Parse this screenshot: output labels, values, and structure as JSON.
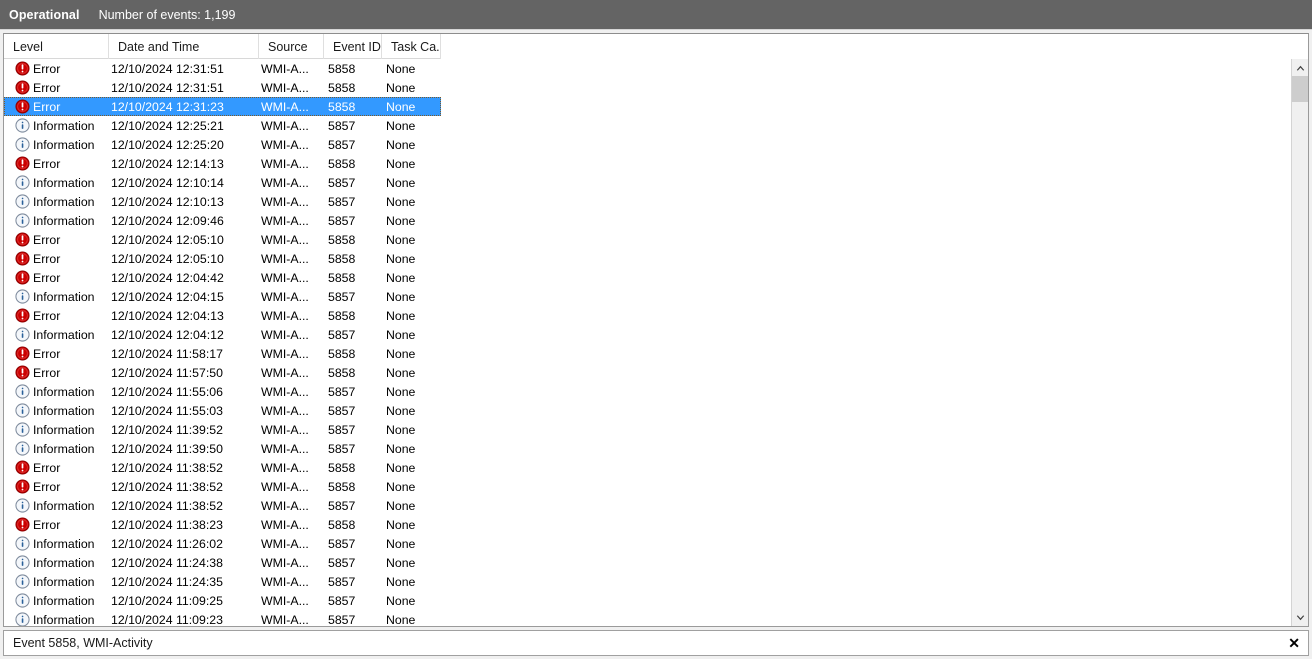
{
  "header": {
    "log_name": "Operational",
    "event_count_label": "Number of events: 1,199"
  },
  "columns": [
    {
      "key": "level",
      "label": "Level"
    },
    {
      "key": "datetime",
      "label": "Date and Time"
    },
    {
      "key": "source",
      "label": "Source"
    },
    {
      "key": "eventid",
      "label": "Event ID"
    },
    {
      "key": "task",
      "label": "Task Ca..."
    }
  ],
  "colors": {
    "titlebar_bg": "#646464",
    "selection_bg": "#3399ff",
    "error_icon": "#cc0000",
    "information_icon": "#2a6099"
  },
  "rows": [
    {
      "level": "Error",
      "icon": "error-icon",
      "datetime": "12/10/2024 12:31:51",
      "source": "WMI-A...",
      "eventid": "5858",
      "task": "None",
      "selected": false
    },
    {
      "level": "Error",
      "icon": "error-icon",
      "datetime": "12/10/2024 12:31:51",
      "source": "WMI-A...",
      "eventid": "5858",
      "task": "None",
      "selected": false
    },
    {
      "level": "Error",
      "icon": "error-icon",
      "datetime": "12/10/2024 12:31:23",
      "source": "WMI-A...",
      "eventid": "5858",
      "task": "None",
      "selected": true
    },
    {
      "level": "Information",
      "icon": "information-icon",
      "datetime": "12/10/2024 12:25:21",
      "source": "WMI-A...",
      "eventid": "5857",
      "task": "None",
      "selected": false
    },
    {
      "level": "Information",
      "icon": "information-icon",
      "datetime": "12/10/2024 12:25:20",
      "source": "WMI-A...",
      "eventid": "5857",
      "task": "None",
      "selected": false
    },
    {
      "level": "Error",
      "icon": "error-icon",
      "datetime": "12/10/2024 12:14:13",
      "source": "WMI-A...",
      "eventid": "5858",
      "task": "None",
      "selected": false
    },
    {
      "level": "Information",
      "icon": "information-icon",
      "datetime": "12/10/2024 12:10:14",
      "source": "WMI-A...",
      "eventid": "5857",
      "task": "None",
      "selected": false
    },
    {
      "level": "Information",
      "icon": "information-icon",
      "datetime": "12/10/2024 12:10:13",
      "source": "WMI-A...",
      "eventid": "5857",
      "task": "None",
      "selected": false
    },
    {
      "level": "Information",
      "icon": "information-icon",
      "datetime": "12/10/2024 12:09:46",
      "source": "WMI-A...",
      "eventid": "5857",
      "task": "None",
      "selected": false
    },
    {
      "level": "Error",
      "icon": "error-icon",
      "datetime": "12/10/2024 12:05:10",
      "source": "WMI-A...",
      "eventid": "5858",
      "task": "None",
      "selected": false
    },
    {
      "level": "Error",
      "icon": "error-icon",
      "datetime": "12/10/2024 12:05:10",
      "source": "WMI-A...",
      "eventid": "5858",
      "task": "None",
      "selected": false
    },
    {
      "level": "Error",
      "icon": "error-icon",
      "datetime": "12/10/2024 12:04:42",
      "source": "WMI-A...",
      "eventid": "5858",
      "task": "None",
      "selected": false
    },
    {
      "level": "Information",
      "icon": "information-icon",
      "datetime": "12/10/2024 12:04:15",
      "source": "WMI-A...",
      "eventid": "5857",
      "task": "None",
      "selected": false
    },
    {
      "level": "Error",
      "icon": "error-icon",
      "datetime": "12/10/2024 12:04:13",
      "source": "WMI-A...",
      "eventid": "5858",
      "task": "None",
      "selected": false
    },
    {
      "level": "Information",
      "icon": "information-icon",
      "datetime": "12/10/2024 12:04:12",
      "source": "WMI-A...",
      "eventid": "5857",
      "task": "None",
      "selected": false
    },
    {
      "level": "Error",
      "icon": "error-icon",
      "datetime": "12/10/2024 11:58:17",
      "source": "WMI-A...",
      "eventid": "5858",
      "task": "None",
      "selected": false
    },
    {
      "level": "Error",
      "icon": "error-icon",
      "datetime": "12/10/2024 11:57:50",
      "source": "WMI-A...",
      "eventid": "5858",
      "task": "None",
      "selected": false
    },
    {
      "level": "Information",
      "icon": "information-icon",
      "datetime": "12/10/2024 11:55:06",
      "source": "WMI-A...",
      "eventid": "5857",
      "task": "None",
      "selected": false
    },
    {
      "level": "Information",
      "icon": "information-icon",
      "datetime": "12/10/2024 11:55:03",
      "source": "WMI-A...",
      "eventid": "5857",
      "task": "None",
      "selected": false
    },
    {
      "level": "Information",
      "icon": "information-icon",
      "datetime": "12/10/2024 11:39:52",
      "source": "WMI-A...",
      "eventid": "5857",
      "task": "None",
      "selected": false
    },
    {
      "level": "Information",
      "icon": "information-icon",
      "datetime": "12/10/2024 11:39:50",
      "source": "WMI-A...",
      "eventid": "5857",
      "task": "None",
      "selected": false
    },
    {
      "level": "Error",
      "icon": "error-icon",
      "datetime": "12/10/2024 11:38:52",
      "source": "WMI-A...",
      "eventid": "5858",
      "task": "None",
      "selected": false
    },
    {
      "level": "Error",
      "icon": "error-icon",
      "datetime": "12/10/2024 11:38:52",
      "source": "WMI-A...",
      "eventid": "5858",
      "task": "None",
      "selected": false
    },
    {
      "level": "Information",
      "icon": "information-icon",
      "datetime": "12/10/2024 11:38:52",
      "source": "WMI-A...",
      "eventid": "5857",
      "task": "None",
      "selected": false
    },
    {
      "level": "Error",
      "icon": "error-icon",
      "datetime": "12/10/2024 11:38:23",
      "source": "WMI-A...",
      "eventid": "5858",
      "task": "None",
      "selected": false
    },
    {
      "level": "Information",
      "icon": "information-icon",
      "datetime": "12/10/2024 11:26:02",
      "source": "WMI-A...",
      "eventid": "5857",
      "task": "None",
      "selected": false
    },
    {
      "level": "Information",
      "icon": "information-icon",
      "datetime": "12/10/2024 11:24:38",
      "source": "WMI-A...",
      "eventid": "5857",
      "task": "None",
      "selected": false
    },
    {
      "level": "Information",
      "icon": "information-icon",
      "datetime": "12/10/2024 11:24:35",
      "source": "WMI-A...",
      "eventid": "5857",
      "task": "None",
      "selected": false
    },
    {
      "level": "Information",
      "icon": "information-icon",
      "datetime": "12/10/2024 11:09:25",
      "source": "WMI-A...",
      "eventid": "5857",
      "task": "None",
      "selected": false
    },
    {
      "level": "Information",
      "icon": "information-icon",
      "datetime": "12/10/2024 11:09:23",
      "source": "WMI-A...",
      "eventid": "5857",
      "task": "None",
      "selected": false
    }
  ],
  "statusbar": {
    "text": "Event 5858, WMI-Activity",
    "close_label": "✕"
  },
  "scrollbar": {
    "up_label": "scroll-up",
    "down_label": "scroll-down"
  }
}
